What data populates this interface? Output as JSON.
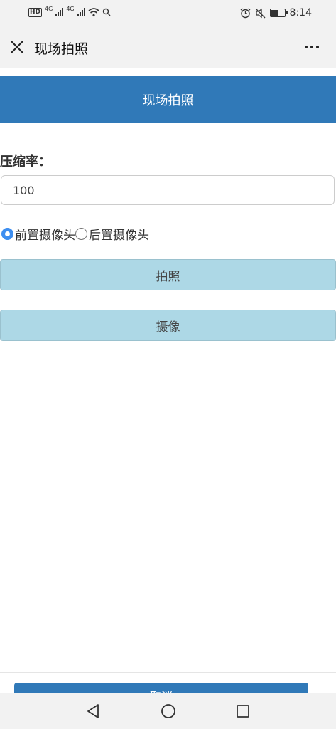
{
  "status_bar": {
    "network_badge": "HD",
    "net_type_1": "4G",
    "net_type_2": "4G",
    "time": "8:14"
  },
  "nav": {
    "title": "现场拍照"
  },
  "header": {
    "title": "现场拍照"
  },
  "form": {
    "compression_label": "压缩率：",
    "compression_value": "100",
    "camera_options": [
      "前置摄像头",
      "后置摄像头"
    ],
    "selected_camera": "前置摄像头"
  },
  "buttons": {
    "photo": "拍照",
    "video": "摄像",
    "cancel": "取消"
  },
  "colors": {
    "primary": "#3079b8",
    "action_button": "#add8e6",
    "radio_selected": "#3d8ef0"
  }
}
